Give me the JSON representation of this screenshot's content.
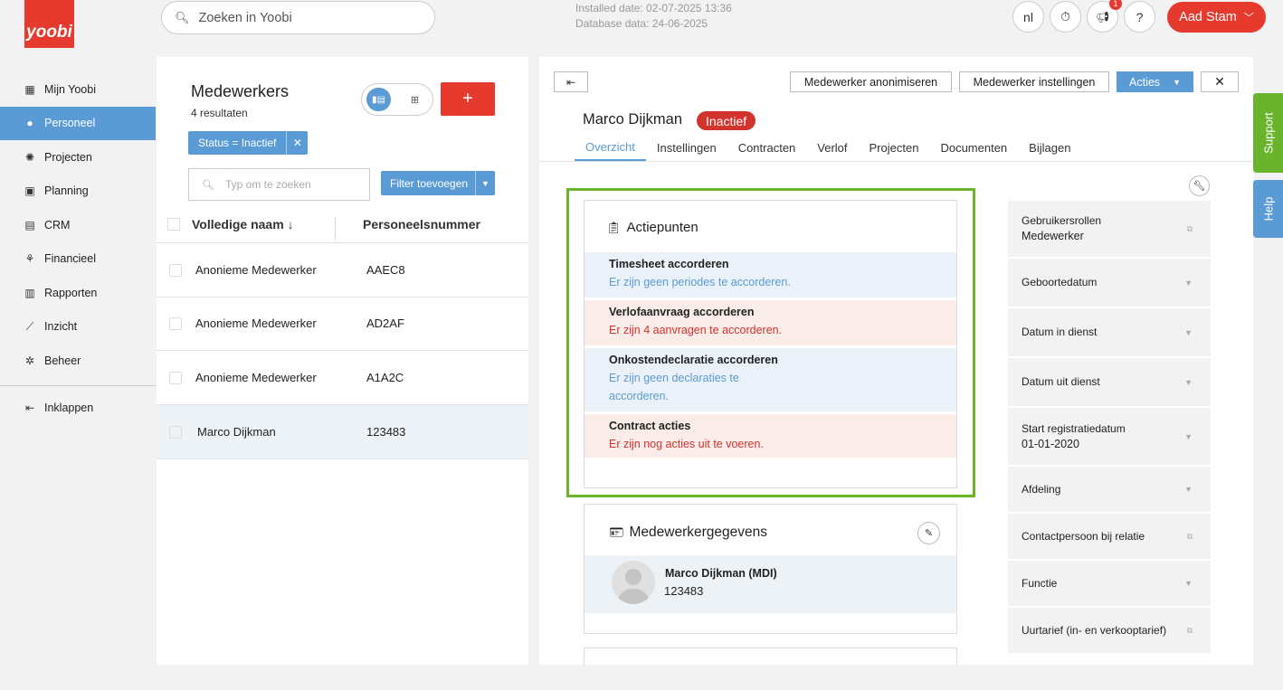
{
  "app": {
    "logo_text": "yoobi",
    "brand_color": "#e63a2e",
    "accent_color": "#5b9bd5",
    "highlight_color": "#6ab42d"
  },
  "sidebar": {
    "items": [
      {
        "label": "Mijn Yoobi",
        "icon": "dashboard-icon"
      },
      {
        "label": "Personeel",
        "icon": "person-icon",
        "active": true
      },
      {
        "label": "Projecten",
        "icon": "lightbulb-icon"
      },
      {
        "label": "Planning",
        "icon": "calendar-icon"
      },
      {
        "label": "CRM",
        "icon": "contacts-icon"
      },
      {
        "label": "Financieel",
        "icon": "coins-icon"
      },
      {
        "label": "Rapporten",
        "icon": "bar-chart-icon"
      },
      {
        "label": "Inzicht",
        "icon": "line-chart-icon"
      },
      {
        "label": "Beheer",
        "icon": "settings-icon"
      }
    ],
    "collapse_label": "Inklappen"
  },
  "topbar": {
    "search_placeholder": "Zoeken in Yoobi",
    "installed_date": "Installed date: 02-07-2025 13:36",
    "database_date": "Database data: 24-06-2025",
    "language": "nl",
    "notification_count": "1",
    "help": "?",
    "user_name": "Aad Stam"
  },
  "list": {
    "title": "Medewerkers",
    "count": "4 resultaten",
    "filter_chip": "Status = Inactief",
    "search_placeholder": "Typ om te zoeken",
    "filter_button": "Filter toevoegen",
    "add_label": "+",
    "columns": {
      "name": "Volledige naam",
      "number": "Personeelsnummer"
    },
    "rows": [
      {
        "name": "Anonieme Medewerker",
        "number": "AAEC8"
      },
      {
        "name": "Anonieme Medewerker",
        "number": "AD2AF"
      },
      {
        "name": "Anonieme Medewerker",
        "number": "A1A2C"
      },
      {
        "name": "Marco Dijkman",
        "number": "123483",
        "selected": true
      }
    ]
  },
  "detail": {
    "buttons": {
      "anonymize": "Medewerker anonimiseren",
      "settings": "Medewerker instellingen",
      "actions": "Acties"
    },
    "employee_name": "Marco Dijkman",
    "status_badge": "Inactief",
    "tabs": [
      "Overzicht",
      "Instellingen",
      "Contracten",
      "Verlof",
      "Projecten",
      "Documenten",
      "Bijlagen"
    ],
    "active_tab": "Overzicht",
    "action_points": {
      "title": "Actiepunten",
      "items": [
        {
          "title": "Timesheet accorderen",
          "desc": "Er zijn geen periodes te accorderen.",
          "tone": "blue"
        },
        {
          "title": "Verlofaanvraag accorderen",
          "desc": "Er zijn 4 aanvragen te accorderen.",
          "tone": "red"
        },
        {
          "title": "Onkostendeclaratie accorderen",
          "desc_line1": "Er zijn geen declaraties te",
          "desc_line2": "accorderen.",
          "tone": "blue"
        },
        {
          "title": "Contract acties",
          "desc": "Er zijn nog acties uit te voeren.",
          "tone": "red"
        }
      ]
    },
    "employee_data": {
      "title": "Medewerkergegevens",
      "display_name": "Marco Dijkman (MDI)",
      "number": "123483"
    },
    "side_fields": [
      {
        "label": "Gebruikersrollen",
        "value": "Medewerker",
        "icon": "copy-icon"
      },
      {
        "label": "Geboortedatum",
        "icon": "caret-down-icon"
      },
      {
        "label": "Datum in dienst",
        "icon": "caret-down-icon"
      },
      {
        "label": "Datum uit dienst",
        "icon": "caret-down-icon"
      },
      {
        "label": "Start registratiedatum",
        "value": "01-01-2020",
        "icon": "caret-down-icon"
      },
      {
        "label": "Afdeling",
        "icon": "caret-down-icon"
      },
      {
        "label": "Contactpersoon bij relatie",
        "icon": "copy-icon"
      },
      {
        "label": "Functie",
        "icon": "caret-down-icon"
      },
      {
        "label": "Uurtarief (in- en verkooptarief)",
        "icon": "copy-icon"
      }
    ]
  },
  "side_tabs": {
    "support": "Support",
    "help": "Help"
  }
}
